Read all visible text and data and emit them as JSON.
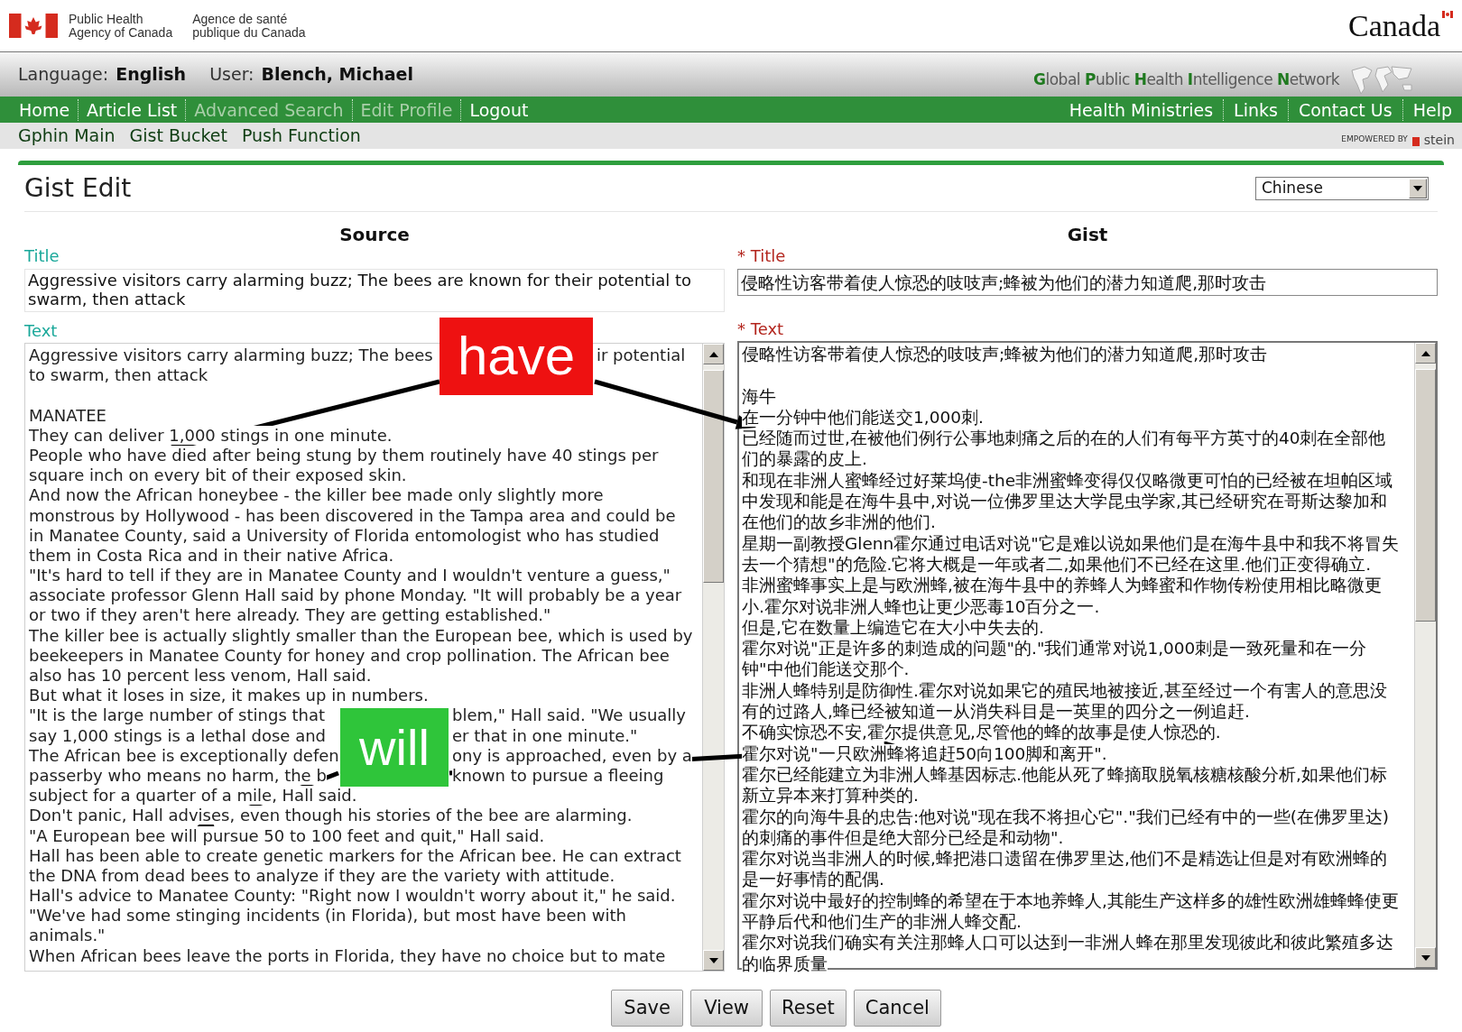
{
  "header": {
    "agency_en": [
      "Public Health",
      "Agency of Canada"
    ],
    "agency_fr": [
      "Agence de santé",
      "publique du Canada"
    ],
    "wordmark": "Canada"
  },
  "user_bar": {
    "language_label": "Language:",
    "language": "English",
    "user_label": "User:",
    "user": "Blench, Michael",
    "network_words": [
      "Global",
      "Public",
      "Health",
      "Intelligence",
      "Network"
    ]
  },
  "nav": {
    "left": [
      {
        "label": "Home",
        "disabled": false
      },
      {
        "label": "Article List",
        "disabled": false
      },
      {
        "label": "Advanced Search",
        "disabled": true
      },
      {
        "label": "Edit Profile",
        "disabled": true
      },
      {
        "label": "Logout",
        "disabled": false
      }
    ],
    "right": [
      {
        "label": "Health Ministries",
        "disabled": false
      },
      {
        "label": "Links",
        "disabled": false
      },
      {
        "label": "Contact Us",
        "disabled": false
      },
      {
        "label": "Help",
        "disabled": false
      }
    ]
  },
  "subnav": [
    "Gphin Main",
    "Gist Bucket",
    "Push Function"
  ],
  "powered_by": {
    "label": "EMPOWERED BY",
    "brand": "stein"
  },
  "page_title": "Gist Edit",
  "language_select": {
    "value": "Chinese"
  },
  "source": {
    "heading": "Source",
    "title_label": "Title",
    "title": "Aggressive visitors carry alarming buzz; The bees are known for their potential to swarm, then attack",
    "text_label": "Text",
    "text_lines": [
      {
        "kind": "widegap",
        "left": "Aggressive visitors carry alarming buzz; The bees",
        "right": "ir potential"
      },
      {
        "kind": "line",
        "text": "to swarm, then attack"
      },
      {
        "kind": "blank"
      },
      {
        "kind": "line",
        "text": "MANATEE"
      },
      {
        "kind": "line",
        "text": "They can deliver 1,000 stings in one minute."
      },
      {
        "kind": "line",
        "text": "People who have died after being stung by them routinely have 40 stings per"
      },
      {
        "kind": "line",
        "text": "square inch on every bit of their exposed skin."
      },
      {
        "kind": "line",
        "text": "And now the African honeybee - the killer bee made only slightly more"
      },
      {
        "kind": "line",
        "text": "monstrous by Hollywood - has been discovered in the Tampa area and could be"
      },
      {
        "kind": "line",
        "text": "in Manatee County, said a University of Florida entomologist who has studied"
      },
      {
        "kind": "line",
        "text": "them in Costa Rica and in their native Africa."
      },
      {
        "kind": "line",
        "text": "\"It's hard to tell if they are in Manatee County and I wouldn't venture a guess,\""
      },
      {
        "kind": "line",
        "text": "associate professor Glenn Hall said by phone Monday. \"It will probably be a year"
      },
      {
        "kind": "line",
        "text": "or two if they aren't here already. They are getting established.\""
      },
      {
        "kind": "line",
        "text": "The killer bee is actually slightly smaller than the European bee, which is used by"
      },
      {
        "kind": "line",
        "text": "beekeepers in Manatee County for honey and crop pollination. The African bee"
      },
      {
        "kind": "line",
        "text": "also has 10 percent less venom, Hall said."
      },
      {
        "kind": "line",
        "text": "But what it loses in size, it makes up in numbers."
      },
      {
        "kind": "narrowgap",
        "left": "\"It is the large number of stings that",
        "right": "blem,\" Hall said. \"We usually"
      },
      {
        "kind": "narrowgap",
        "left": "say 1,000 stings is a lethal dose and",
        "right": "er that in one minute.\""
      },
      {
        "kind": "narrowgap",
        "left": "The African bee is exceptionally defen",
        "right": "ony is approached, even by a"
      },
      {
        "kind": "narrowgap",
        "left": "passerby who means no harm, the b",
        "right": "known to pursue a fleeing"
      },
      {
        "kind": "line",
        "text": "subject for a quarter of a mile, Hall said."
      },
      {
        "kind": "line",
        "text": "Don't panic, Hall advises, even though his stories of the bee are alarming."
      },
      {
        "kind": "line",
        "text": "\"A European bee will pursue 50 to 100 feet and quit,\" Hall said."
      },
      {
        "kind": "line",
        "text": "Hall has been able to create genetic markers for the African bee. He can extract"
      },
      {
        "kind": "line",
        "text": "the DNA from dead bees to analyze if they are the variety with attitude."
      },
      {
        "kind": "line",
        "text": "Hall's advice to Manatee County: \"Right now I wouldn't worry about it,\" he said."
      },
      {
        "kind": "line",
        "text": "\"We've had some stinging incidents (in Florida), but most have been with"
      },
      {
        "kind": "line",
        "text": "animals.\""
      },
      {
        "kind": "line",
        "text": "When African bees leave the ports in Florida, they have no choice but to mate"
      }
    ]
  },
  "gist": {
    "heading": "Gist",
    "title_label": "* Title",
    "title": "侵略性访客带着使人惊恐的吱吱声;蜂被为他们的潜力知道爬,那时攻击",
    "text_label": "* Text",
    "text_lines": [
      {
        "kind": "line",
        "text": "侵略性访客带着使人惊恐的吱吱声;蜂被为他们的潜力知道爬,那时攻击"
      },
      {
        "kind": "blank"
      },
      {
        "kind": "line",
        "text": "海牛"
      },
      {
        "kind": "line",
        "text": "在一分钟中他们能送交1,000刺."
      },
      {
        "kind": "line",
        "text": "已经随而过世,在被他们例行公事地刺痛之后的在的人们有每平方英寸的40刺在全部他"
      },
      {
        "kind": "line",
        "text": "们的暴露的皮上."
      },
      {
        "kind": "line",
        "text": "和现在非洲人蜜蜂经过好莱坞使-the非洲蜜蜂变得仅仅略微更可怕的已经被在坦帕区域"
      },
      {
        "kind": "line",
        "text": "中发现和能是在海牛县中,对说一位佛罗里达大学昆虫学家,其已经研究在哥斯达黎加和"
      },
      {
        "kind": "line",
        "text": "在他们的故乡非洲的他们."
      },
      {
        "kind": "line",
        "text": "星期一副教授Glenn霍尔通过电话对说\"它是难以说如果他们是在海牛县中和我不将冒失"
      },
      {
        "kind": "line",
        "text": "去一个猜想\"的危险.它将大概是一年或者二,如果他们不已经在这里.他们正变得确立."
      },
      {
        "kind": "line",
        "text": "非洲蜜蜂事实上是与欧洲蜂,被在海牛县中的养蜂人为蜂蜜和作物传粉使用相比略微更"
      },
      {
        "kind": "line",
        "text": "小.霍尔对说非洲人蜂也让更少恶毒10百分之一."
      },
      {
        "kind": "line",
        "text": "但是,它在数量上编造它在大小中失去的."
      },
      {
        "kind": "line",
        "text": "霍尔对说\"正是许多的刺造成的问题\"的.\"我们通常对说1,000刺是一致死量和在一分"
      },
      {
        "kind": "line",
        "text": "钟\"中他们能送交那个."
      },
      {
        "kind": "line",
        "text": "非洲人蜂特别是防御性.霍尔对说如果它的殖民地被接近,甚至经过一个有害人的意思没"
      },
      {
        "kind": "line",
        "text": "有的过路人,蜂已经被知道一从消失科目是一英里的四分之一例追赶."
      },
      {
        "kind": "line",
        "text": "不确实惊恐不安,霍尔提供意见,尽管他的蜂的故事是使人惊恐的."
      },
      {
        "kind": "line",
        "text": "霍尔对说\"一只欧洲蜂将追赶50向100脚和离开\"."
      },
      {
        "kind": "line",
        "text": "霍尔已经能建立为非洲人蜂基因标志.他能从死了蜂摘取脱氧核糖核酸分析,如果他们标"
      },
      {
        "kind": "line",
        "text": "新立异本来打算种类的."
      },
      {
        "kind": "line",
        "text": "霍尔的向海牛县的忠告:他对说\"现在我不将担心它\".\"我们已经有中的一些(在佛罗里达)"
      },
      {
        "kind": "line",
        "text": "的刺痛的事件但是绝大部分已经是和动物\"."
      },
      {
        "kind": "line",
        "text": "霍尔对说当非洲人的时候,蜂把港口遗留在佛罗里达,他们不是精选让但是对有欧洲蜂的"
      },
      {
        "kind": "line",
        "text": "是一好事情的配偶."
      },
      {
        "kind": "line",
        "text": "霍尔对说中最好的控制蜂的希望在于本地养蜂人,其能生产这样多的雄性欧洲雄蜂蜂使更"
      },
      {
        "kind": "line",
        "text": "平静后代和他们生产的非洲人蜂交配."
      },
      {
        "kind": "line",
        "text": "霍尔对说我们确实有关注那蜂人口可以达到一非洲人蜂在那里发现彼此和彼此繁殖多达"
      },
      {
        "kind": "line",
        "text": "的临界质量"
      }
    ]
  },
  "buttons": [
    "Save",
    "View",
    "Reset",
    "Cancel"
  ],
  "callouts": [
    {
      "label": "have",
      "color": "#ee1111"
    },
    {
      "label": "will",
      "color": "#2fc53a"
    }
  ]
}
